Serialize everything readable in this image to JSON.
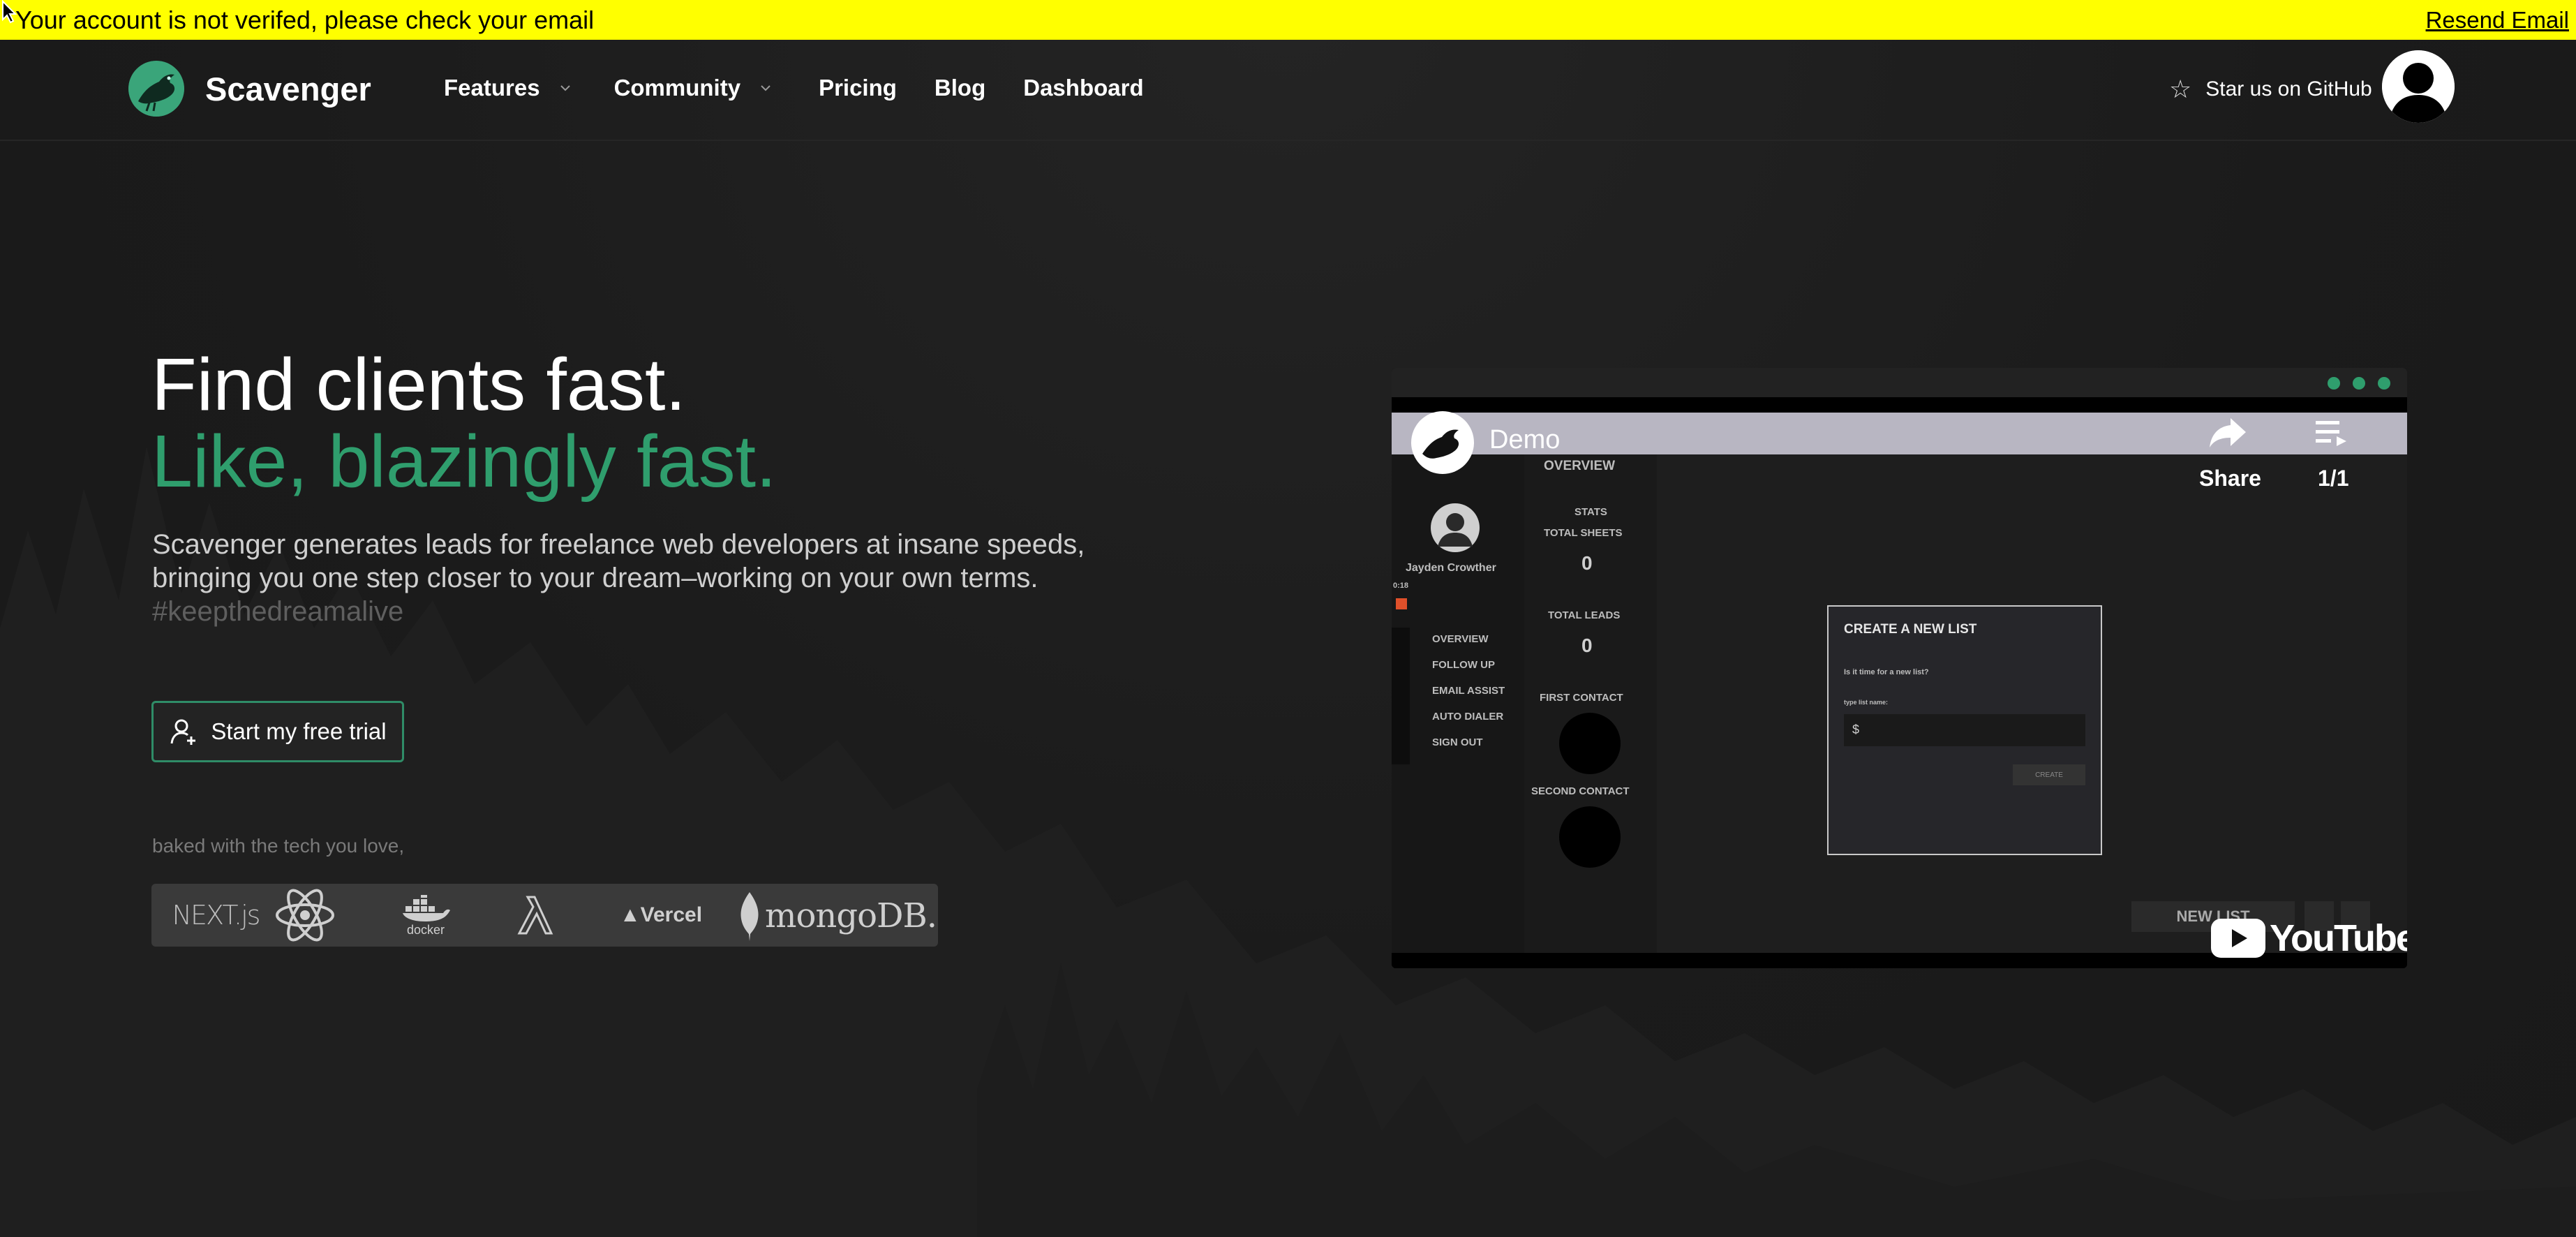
{
  "banner": {
    "message": "Your account is not verifed, please check your email",
    "action": "Resend Email"
  },
  "nav": {
    "brand": "Scavenger",
    "items": [
      {
        "label": "Features",
        "has_dropdown": true
      },
      {
        "label": "Community",
        "has_dropdown": true
      },
      {
        "label": "Pricing"
      },
      {
        "label": "Blog"
      },
      {
        "label": "Dashboard"
      }
    ],
    "github": "Star us on GitHub"
  },
  "hero": {
    "title_line1": "Find clients fast.",
    "title_line2": "Like, blazingly fast.",
    "subtitle_line1": "Scavenger generates leads for freelance web developers at insane speeds,",
    "subtitle_line2": "bringing you one step closer to your dream–working on your own terms.",
    "hashtag": "#keepthedreamalive",
    "cta": "Start my free trial",
    "baked": "baked with the tech you love,",
    "tech": [
      "NEXT.js",
      "react-icon",
      "docker",
      "lambda-icon",
      "▲Vercel",
      "mongoDB."
    ]
  },
  "video": {
    "title": "Demo",
    "share": "Share",
    "counter": "1/1",
    "youtube": "YouTube",
    "app": {
      "user": "Jayden Crowther",
      "time": "0:18",
      "overview_header": "OVERVIEW",
      "stats": "STATS",
      "total_sheets": "TOTAL SHEETS",
      "total_sheets_value": "0",
      "total_leads": "TOTAL LEADS",
      "total_leads_value": "0",
      "first_contact": "FIRST CONTACT",
      "second_contact": "SECOND CONTACT",
      "menu": [
        "OVERVIEW",
        "FOLLOW UP",
        "EMAIL ASSIST",
        "AUTO DIALER",
        "SIGN OUT"
      ],
      "modal_title": "CREATE A NEW LIST",
      "modal_question": "Is it time for a new list?",
      "modal_field_label": "type list name:",
      "modal_prefix": "$",
      "modal_button": "CREATE",
      "new_list": "NEW LIST"
    }
  },
  "colors": {
    "banner": "#ffff00",
    "accent": "#2f9e6d",
    "background": "#1b1b1b"
  }
}
